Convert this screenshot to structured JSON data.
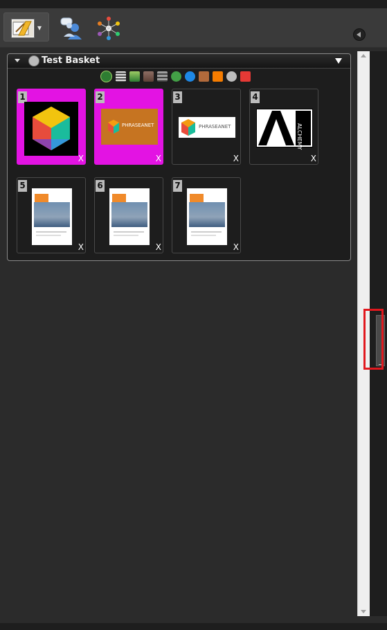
{
  "basket": {
    "title": "Test Basket",
    "items": [
      {
        "num": "1",
        "remove": "X"
      },
      {
        "num": "2",
        "remove": "X"
      },
      {
        "num": "3",
        "remove": "X"
      },
      {
        "num": "4",
        "remove": "X"
      },
      {
        "num": "5",
        "remove": "X"
      },
      {
        "num": "6",
        "remove": "X"
      },
      {
        "num": "7",
        "remove": "X"
      }
    ],
    "logo_text_phraseanet": "PHRASEANET",
    "logo_text_alchemy": "ALCHEMY"
  },
  "toolbar": {
    "caret": "▾"
  },
  "colors": {
    "selected": "#e313e3",
    "panel": "#3a3a3a",
    "highlight_box": "#e2181e"
  },
  "icons": [
    "edit-dropdown-icon",
    "users-chat-icon",
    "network-star-icon",
    "collapse-icon",
    "basket-icon",
    "info-icon",
    "list-icon",
    "download-icon",
    "print-icon",
    "stack-icon",
    "recycle-icon",
    "help-icon",
    "bridge-icon",
    "rss-icon",
    "settings-icon",
    "delete-icon"
  ]
}
